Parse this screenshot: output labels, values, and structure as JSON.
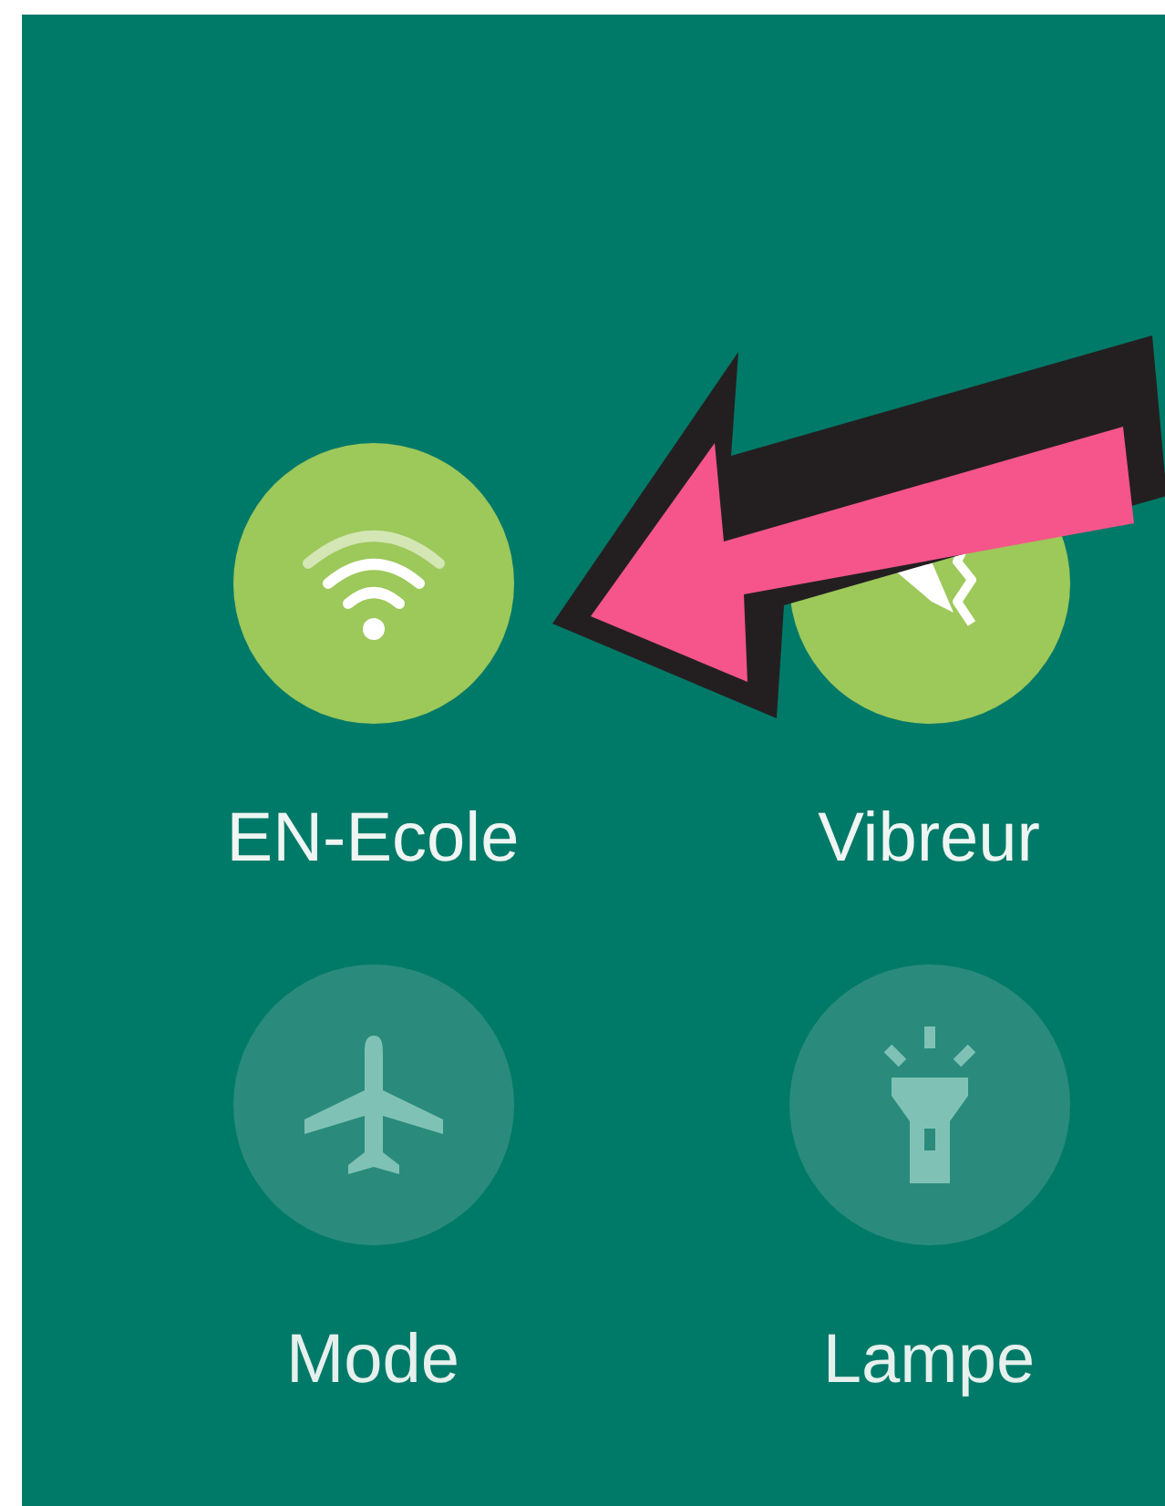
{
  "tiles": [
    {
      "label": "EN-Ecole",
      "on": true,
      "kind": "wifi"
    },
    {
      "label": "Vibreur",
      "on": true,
      "kind": "vibrate"
    },
    {
      "label": "Mode",
      "on": false,
      "kind": "airplane"
    },
    {
      "label": "Lampe",
      "on": false,
      "kind": "flashlight"
    }
  ]
}
